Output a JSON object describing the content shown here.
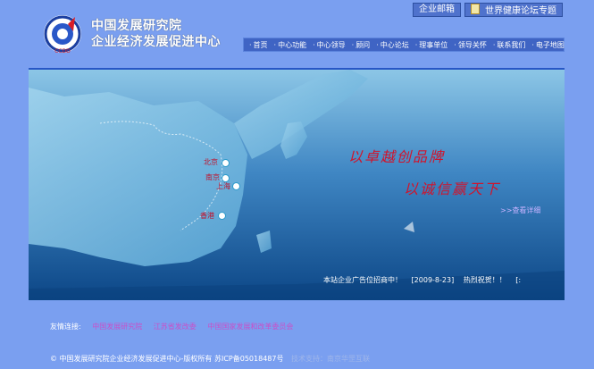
{
  "header": {
    "org_name_line1": "中国发展研究院",
    "org_name_line2": "企业经济发展促进中心",
    "logo_text": "CCDD"
  },
  "top_links": [
    {
      "label": "企业邮箱"
    },
    {
      "label": "世界健康论坛专题",
      "icon": "document-icon"
    }
  ],
  "nav": {
    "items": [
      "首页",
      "中心功能",
      "中心领导",
      "顾问",
      "中心论坛",
      "理事单位",
      "领导关怀",
      "联系我们",
      "电子地图"
    ]
  },
  "banner": {
    "cities": [
      "北京",
      "南京",
      "上海",
      "香港"
    ],
    "slogan_line1": "以卓越创品牌",
    "slogan_line2": "以诚信赢天下",
    "more_link": ">>查看详细",
    "ticker": {
      "item1": "本站企业广告位招商中！",
      "date": "[2009-8-23]",
      "item2": "热烈祝贺！！",
      "item3": "[:"
    }
  },
  "friend_links": {
    "label": "友情连接:",
    "links": [
      "中国发展研究院",
      "江苏省发改委",
      "中国国家发展和改革委员会"
    ]
  },
  "footer": {
    "copyright": "© 中国发展研究院企业经济发展促进中心-版权所有",
    "icp": "苏ICP备05018487号",
    "tech": "技术支持：南京华罡互联"
  },
  "colors": {
    "page_background": "#7a9ff0",
    "nav_background": "#3f64c4",
    "slogan_red": "#d0142c",
    "friend_link": "#c94fc8"
  }
}
